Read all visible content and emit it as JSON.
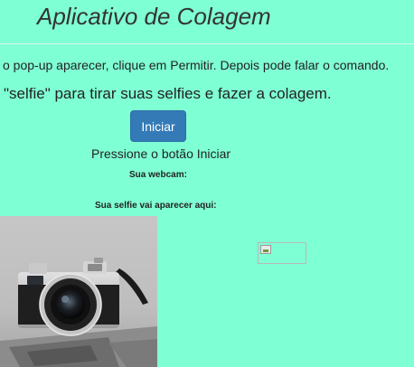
{
  "app": {
    "title": "Aplicativo de Colagem"
  },
  "instructions": {
    "permission_text": "o pop-up aparecer, clique em Permitir. Depois pode falar o comando.",
    "command_text": "\"selfie\" para tirar suas selfies e fazer a colagem."
  },
  "controls": {
    "start_button_label": "Iniciar",
    "start_hint": "Pressione o botão Iniciar"
  },
  "sections": {
    "webcam_label": "Sua webcam:",
    "selfie_label": "Sua selfie vai aparecer aqui:"
  },
  "images": {
    "webcam_frame": "camera-photo",
    "selfie_placeholder": "broken-image-icon"
  },
  "colors": {
    "background": "#7fffd4",
    "button": "#337ab7",
    "button_text": "#ffffff"
  }
}
